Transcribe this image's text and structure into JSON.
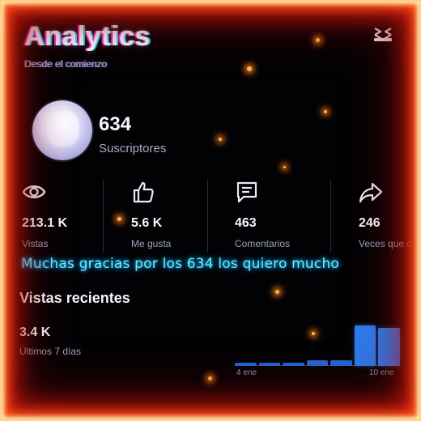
{
  "header": {
    "title": "Analytics",
    "subtitle": "Desde el comienzo"
  },
  "channel": {
    "subscribers": "634",
    "subscribers_label": "Suscriptores"
  },
  "stats": [
    {
      "icon": "eye-icon",
      "value": "213.1 K",
      "label": "Vistas"
    },
    {
      "icon": "thumbs-up-icon",
      "value": "5.6 K",
      "label": "Me gusta"
    },
    {
      "icon": "comment-icon",
      "value": "463",
      "label": "Comentarios"
    },
    {
      "icon": "share-icon",
      "value": "246",
      "label": "Veces que c"
    }
  ],
  "overlay_text": "Muchas gracias por los 634 los quiero mucho",
  "recent": {
    "title": "Vistas recientes",
    "value": "3.4 K",
    "label": "Últimos 7 días"
  },
  "chart_data": {
    "type": "bar",
    "x_tick_labels": [
      "4 ene",
      "10 ene"
    ],
    "values": [
      0.08,
      0.08,
      0.08,
      0.15,
      0.15,
      1.0,
      0.95
    ],
    "highlighted": [
      false,
      false,
      false,
      false,
      false,
      true,
      true
    ],
    "bar_color": "#1e67d6"
  },
  "colors": {
    "accent_glow": "#6ee8ff",
    "fire": "#ff5a1a"
  }
}
